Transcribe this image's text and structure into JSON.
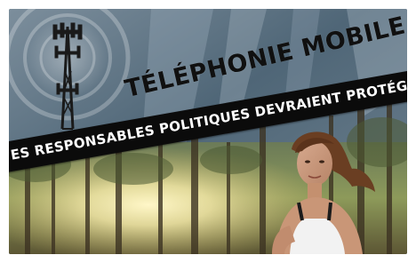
{
  "headline": {
    "title": "TÉLÉPHONIE MOBILE :",
    "subtitle": "ES RESPONSABLES POLITIQUES DEVRAIENT PROTÉGER LA SANT"
  },
  "scene": {
    "subjects": [
      "cell-tower-icon",
      "woman-jogging",
      "forest-trees",
      "sunlight"
    ]
  },
  "colors": {
    "banner": "#0b0b0b",
    "banner_text": "#ffffff",
    "title_text": "#101010",
    "sky": "#5a6f80",
    "sunlight": "#f2e6a6"
  }
}
